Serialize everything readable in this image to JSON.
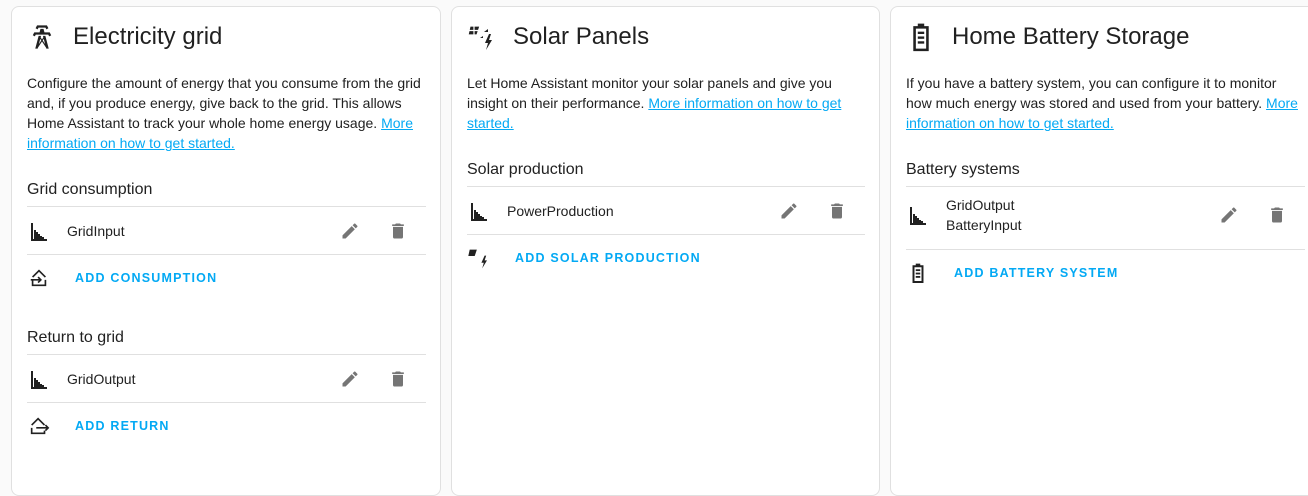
{
  "colors": {
    "accent": "#03a9f4",
    "icon": "#212121",
    "action_icon": "#757575",
    "divider": "#e0e0e0"
  },
  "grid": {
    "title": "Electricity grid",
    "icon": "transmission-tower-icon",
    "description": "Configure the amount of energy that you consume from the grid and, if you produce energy, give back to the grid. This allows Home Assistant to track your whole home energy usage.",
    "link_text": "More information on how to get started.",
    "consumption": {
      "title": "Grid consumption",
      "items": [
        {
          "label": "GridInput"
        }
      ],
      "add_label": "ADD CONSUMPTION"
    },
    "return": {
      "title": "Return to grid",
      "items": [
        {
          "label": "GridOutput"
        }
      ],
      "add_label": "ADD RETURN"
    }
  },
  "solar": {
    "title": "Solar Panels",
    "icon": "solar-power-icon",
    "description": "Let Home Assistant monitor your solar panels and give you insight on their performance.",
    "link_text": "More information on how to get started.",
    "production": {
      "title": "Solar production",
      "items": [
        {
          "label": "PowerProduction"
        }
      ],
      "add_label": "ADD SOLAR PRODUCTION"
    }
  },
  "battery": {
    "title": "Home Battery Storage",
    "icon": "battery-icon",
    "description": "If you have a battery system, you can configure it to monitor how much energy was stored and used from your battery.",
    "link_text": "More information on how to get started.",
    "systems": {
      "title": "Battery systems",
      "items": [
        {
          "line1": "GridOutput",
          "line2": "BatteryInput"
        }
      ],
      "add_label": "ADD BATTERY SYSTEM"
    }
  }
}
